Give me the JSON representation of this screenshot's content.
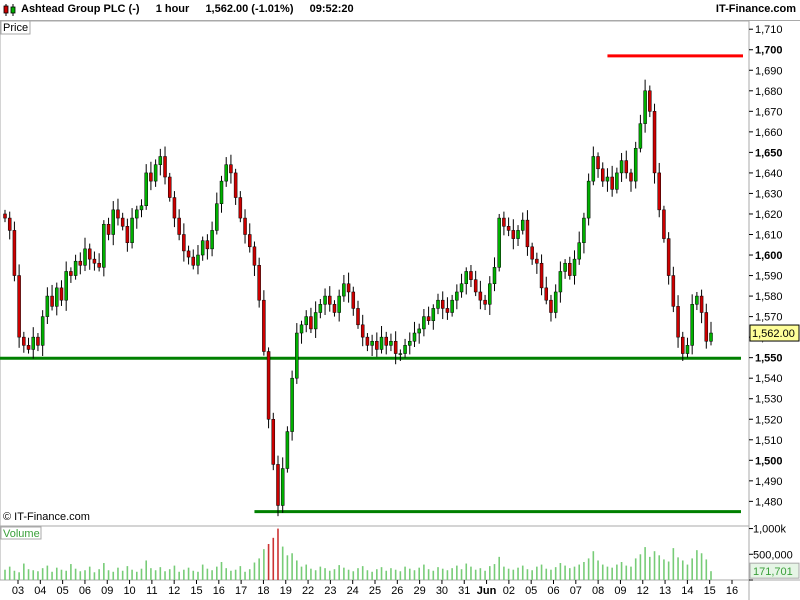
{
  "header": {
    "title": "Ashtead Group PLC (-)",
    "interval": "1 hour",
    "quote": "1,562.00 (-1.01%)",
    "time": "09:52:20",
    "brand": "IT-Finance.com"
  },
  "chart_data": [
    {
      "type": "candlestick",
      "title": "Ashtead Group PLC (-)",
      "panel_label": "Price",
      "watermark": "© IT-Finance.com",
      "ylim": [
        1468,
        1714
      ],
      "y_ticks": [
        1480,
        1490,
        1500,
        1510,
        1520,
        1530,
        1540,
        1550,
        1560,
        1570,
        1580,
        1590,
        1600,
        1610,
        1620,
        1630,
        1640,
        1650,
        1660,
        1670,
        1680,
        1690,
        1700,
        1710
      ],
      "y_tick_labels": [
        "1,480",
        "1,490",
        "1,500",
        "1,510",
        "1,520",
        "1,530",
        "1,540",
        "1,550",
        "1,560",
        "1,570",
        "1,580",
        "1,590",
        "1,600",
        "1,610",
        "1,620",
        "1,630",
        "1,640",
        "1,650",
        "1,660",
        "1,670",
        "1,680",
        "1,690",
        "1,700",
        "1,710"
      ],
      "y_ticks_bold": [
        "1,500",
        "1,550",
        "1,600",
        "1,650",
        "1,700"
      ],
      "x_labels": [
        "03",
        "04",
        "05",
        "06",
        "09",
        "10",
        "11",
        "12",
        "15",
        "16",
        "17",
        "18",
        "19",
        "22",
        "23",
        "24",
        "25",
        "26",
        "29",
        "30",
        "31",
        "Jun",
        "02",
        "05",
        "06",
        "07",
        "08",
        "09",
        "12",
        "13",
        "14",
        "15",
        "16"
      ],
      "last_price": 1562.0,
      "last_price_label": "1,562.00",
      "closes": [
        1618,
        1612,
        1590,
        1560,
        1556,
        1554,
        1560,
        1556,
        1570,
        1580,
        1575,
        1584,
        1578,
        1592,
        1590,
        1597,
        1595,
        1603,
        1598,
        1596,
        1594,
        1615,
        1610,
        1622,
        1618,
        1614,
        1606,
        1618,
        1622,
        1624,
        1640,
        1636,
        1644,
        1648,
        1638,
        1628,
        1618,
        1610,
        1602,
        1599,
        1595,
        1600,
        1607,
        1603,
        1612,
        1625,
        1636,
        1644,
        1640,
        1628,
        1618,
        1610,
        1604,
        1595,
        1578,
        1553,
        1520,
        1498,
        1478,
        1496,
        1514,
        1540,
        1562,
        1566,
        1570,
        1564,
        1572,
        1576,
        1580,
        1576,
        1572,
        1580,
        1586,
        1582,
        1574,
        1566,
        1560,
        1556,
        1558,
        1554,
        1560,
        1556,
        1558,
        1552,
        1552,
        1556,
        1558,
        1562,
        1564,
        1570,
        1568,
        1574,
        1578,
        1574,
        1572,
        1578,
        1582,
        1586,
        1592,
        1588,
        1582,
        1578,
        1576,
        1586,
        1594,
        1618,
        1614,
        1612,
        1608,
        1612,
        1617,
        1604,
        1598,
        1596,
        1584,
        1578,
        1572,
        1582,
        1592,
        1596,
        1590,
        1598,
        1606,
        1618,
        1636,
        1648,
        1642,
        1636,
        1638,
        1632,
        1640,
        1646,
        1640,
        1636,
        1652,
        1664,
        1680,
        1670,
        1640,
        1622,
        1608,
        1590,
        1575,
        1560,
        1552,
        1556,
        1576,
        1580,
        1572,
        1558,
        1562
      ],
      "volume_panel": {
        "label": "Volume",
        "ticks": [
          0,
          500000,
          1000000
        ],
        "tick_labels": [
          "0",
          "500,000",
          "1,000k"
        ],
        "ylim": [
          0,
          1050000
        ],
        "last_volume_label": "171,701",
        "values": [
          200000,
          260000,
          180000,
          150000,
          320000,
          210000,
          190000,
          170000,
          230000,
          280000,
          160000,
          240000,
          200000,
          180000,
          310000,
          220000,
          170000,
          190000,
          260000,
          150000,
          210000,
          330000,
          190000,
          160000,
          240000,
          180000,
          270000,
          200000,
          160000,
          220000,
          380000,
          230000,
          190000,
          250000,
          170000,
          210000,
          280000,
          160000,
          200000,
          240000,
          180000,
          160000,
          300000,
          220000,
          190000,
          260000,
          350000,
          230000,
          180000,
          200000,
          270000,
          160000,
          210000,
          340000,
          420000,
          600000,
          700000,
          820000,
          1000000,
          650000,
          480000,
          520000,
          380000,
          260000,
          300000,
          220000,
          190000,
          260000,
          230000,
          180000,
          210000,
          290000,
          240000,
          200000,
          170000,
          230000,
          270000,
          190000,
          160000,
          210000,
          250000,
          180000,
          230000,
          200000,
          170000,
          260000,
          220000,
          190000,
          240000,
          300000,
          210000,
          180000,
          250000,
          220000,
          190000,
          230000,
          280000,
          210000,
          320000,
          260000,
          200000,
          230000,
          180000,
          270000,
          310000,
          450000,
          260000,
          220000,
          200000,
          240000,
          280000,
          210000,
          190000,
          260000,
          300000,
          220000,
          200000,
          250000,
          330000,
          280000,
          230000,
          260000,
          300000,
          350000,
          420000,
          560000,
          380000,
          300000,
          260000,
          240000,
          300000,
          350000,
          280000,
          260000,
          420000,
          500000,
          640000,
          450000,
          560000,
          480000,
          400000,
          360000,
          620000,
          440000,
          380000,
          300000,
          420000,
          580000,
          520000,
          400000,
          171701
        ]
      }
    }
  ],
  "annotations": [
    {
      "name": "resistance-line",
      "color": "#ff0000",
      "level": 1697,
      "from_index": 128,
      "to_index": 156
    },
    {
      "name": "support-line",
      "color": "#008000",
      "level": 1549.7,
      "from_index": 0,
      "to_index": 150
    },
    {
      "name": "low-line",
      "color": "#008000",
      "level": 1475,
      "from_index": 53,
      "to_index": 150
    }
  ],
  "colors": {
    "up": "#00b000",
    "down": "#cc0000",
    "wick": "#000000",
    "volume": "#77cc77",
    "volume_spike": "#cc3333",
    "grid_frame": "#a9a9a9"
  }
}
